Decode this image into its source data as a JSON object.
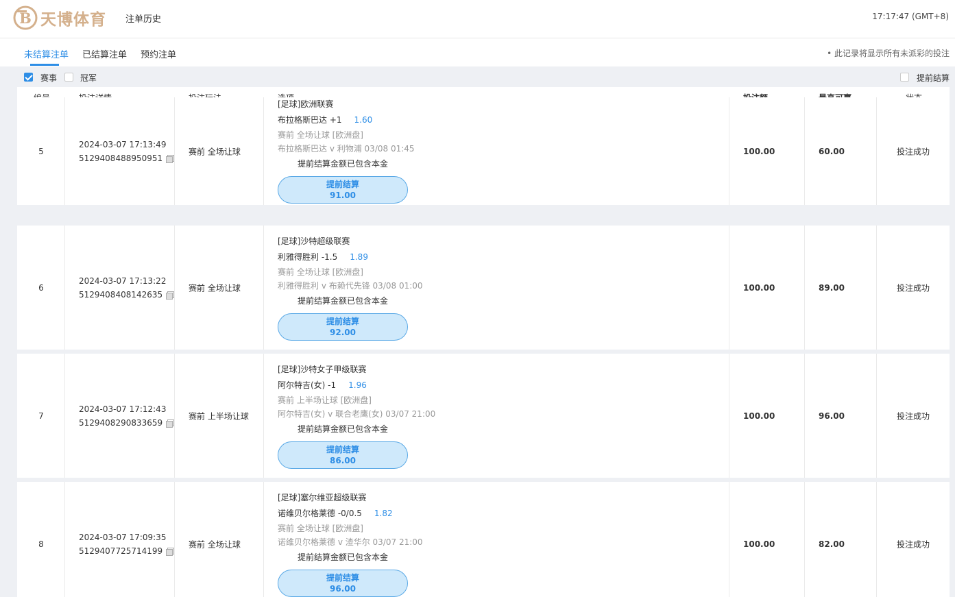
{
  "header": {
    "logo_text": "天博体育",
    "page_title": "注单历史",
    "clock": "17:17:47 (GMT+8)"
  },
  "tabs": [
    {
      "label": "未结算注单",
      "active": true
    },
    {
      "label": "已结算注单",
      "active": false
    },
    {
      "label": "预约注单",
      "active": false
    }
  ],
  "notice": "• 此记录将显示所有未派彩的投注",
  "filters": {
    "event_label": "赛事",
    "event_checked": true,
    "champion_label": "冠军",
    "champion_checked": false,
    "early_settle_label": "提前结算",
    "early_settle_checked": false
  },
  "table": {
    "headers": {
      "no": "编号",
      "detail": "投注详情",
      "bet_type": "投注玩法",
      "option": "选项",
      "stake": "投注额",
      "max_win": "最高可赢",
      "status": "状态"
    },
    "cashout_note": "提前结算金额已包含本金",
    "cashout_label": "提前结算",
    "rows": [
      {
        "no": "5",
        "time": "2024-03-07 17:13:49",
        "order_id": "5129408488950951",
        "bet_type": "赛前 全场让球",
        "league": "[足球]欧洲联赛",
        "selection": "布拉格斯巴达 +1",
        "odds": "1.60",
        "market": "赛前   全场让球   [欧洲盘]",
        "match": "布拉格斯巴达 v 利物浦    03/08 01:45",
        "cashout_amount": "91.00",
        "stake": "100.00",
        "max_win": "60.00",
        "status": "投注成功"
      },
      {
        "no": "6",
        "time": "2024-03-07 17:13:22",
        "order_id": "5129408408142635",
        "bet_type": "赛前 全场让球",
        "league": "[足球]沙特超级联赛",
        "selection": "利雅得胜利 -1.5",
        "odds": "1.89",
        "market": "赛前   全场让球   [欧洲盘]",
        "match": "利雅得胜利 v 布赖代先锋    03/08 01:00",
        "cashout_amount": "92.00",
        "stake": "100.00",
        "max_win": "89.00",
        "status": "投注成功"
      },
      {
        "no": "7",
        "time": "2024-03-07 17:12:43",
        "order_id": "5129408290833659",
        "bet_type": "赛前 上半场让球",
        "league": "[足球]沙特女子甲级联赛",
        "selection": "阿尔特吉(女) -1",
        "odds": "1.96",
        "market": "赛前   上半场让球   [欧洲盘]",
        "match": "阿尔特吉(女) v 联合老鹰(女)    03/07 21:00",
        "cashout_amount": "86.00",
        "stake": "100.00",
        "max_win": "96.00",
        "status": "投注成功"
      },
      {
        "no": "8",
        "time": "2024-03-07 17:09:35",
        "order_id": "5129407725714199",
        "bet_type": "赛前 全场让球",
        "league": "[足球]塞尔维亚超级联赛",
        "selection": "诺维贝尔格莱德 -0/0.5",
        "odds": "1.82",
        "market": "赛前   全场让球   [欧洲盘]",
        "match": "诺维贝尔格莱德 v 渣华尔    03/07 21:00",
        "cashout_amount": "96.00",
        "stake": "100.00",
        "max_win": "82.00",
        "status": "投注成功"
      }
    ]
  },
  "colors": {
    "accent": "#2e8ee6",
    "logo": "#d4b08c",
    "background": "#eef0f4",
    "cashout_fill": "#cfe9fb"
  }
}
